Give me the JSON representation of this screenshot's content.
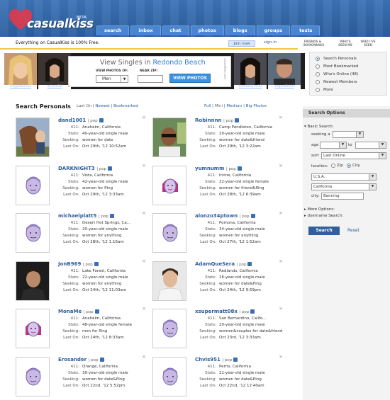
{
  "app": {
    "logo": "casualkiss",
    "beta": "BETA"
  },
  "nav_tabs": [
    "search",
    "inbox",
    "chat",
    "photos",
    "blogs",
    "groups",
    "tests"
  ],
  "top_strip": {
    "message": "Everything on CasualKiss is 100% Free.",
    "join": "Join now",
    "signin": "sign-in"
  },
  "right_tabs": [
    "FRIENDS & BOOKMARKS",
    "WHO'S SEEN ME",
    "WHO I'VE SEEN"
  ],
  "photo_strip": [
    {
      "name": "Heyjude2222"
    },
    {
      "name": "asian429"
    },
    {
      "name": "blonde4you30"
    },
    {
      "name": "Vegas40440"
    }
  ],
  "ad": {
    "title_prefix": "View Singles in",
    "city": "Redondo Beach",
    "view_photos_of_label": "VIEW PHOTOS OF:",
    "near_zip_label": "NEAR ZIP:",
    "gender_value": "Men",
    "button": "VIEW PHOTOS",
    "side_text": "casualkiss.com"
  },
  "right_menu": [
    {
      "label": "Search Personals",
      "selected": true
    },
    {
      "label": "Most Bookmarked",
      "selected": false
    },
    {
      "label": "Who's Online (48)",
      "selected": false
    },
    {
      "label": "Newest Members",
      "selected": false
    },
    {
      "label": "More",
      "selected": false
    }
  ],
  "search_heading": {
    "title": "Search Personals",
    "sort_links": [
      "Last On",
      "Newest",
      "Bookmarked"
    ],
    "view_links": [
      "Full",
      "Mini",
      "Medium",
      "Big Photos"
    ]
  },
  "profiles": [
    {
      "name": "dand1001",
      "pop": "pop",
      "avatar": "photo-horse",
      "r411": "Anaheim, California",
      "stats": "40-year-old single male",
      "seeking": "women for date",
      "last_on": "Oct 29th, '12 10:52am"
    },
    {
      "name": "Robinnnn",
      "pop": "pop",
      "avatar": "photo-man-sunglasses",
      "r411": "Camp Pendleton, California",
      "stats": "20-year-old single male",
      "seeking": "women for date&friend",
      "last_on": "Oct 29th, '12 3:22am"
    },
    {
      "name": "DARKNIGHT3",
      "pop": "pop",
      "avatar": "default-male",
      "r411": "Vista, California",
      "stats": "42-year-old single male",
      "seeking": "women for fling",
      "last_on": "Oct 29th, '12 3:33am"
    },
    {
      "name": "yumnumm",
      "pop": "pop",
      "avatar": "default-female",
      "r411": "Irvine, California",
      "stats": "22-year-old single female",
      "seeking": "women for friend&fling",
      "last_on": "Oct 28th, '12 6:39am"
    },
    {
      "name": "michaelplatt5",
      "pop": "pop",
      "avatar": "default-male",
      "r411": "Desert Hot Springs, Ca...",
      "stats": "20-year-old single male",
      "seeking": "women for anything",
      "last_on": "Oct 28th, '12 1:16am"
    },
    {
      "name": "alonzo34ptown",
      "pop": "pop",
      "avatar": "default-male",
      "r411": "Pomona, California",
      "stats": "34-year-old single male",
      "seeking": "women for anything",
      "last_on": "Oct 27th, '12 1:52am"
    },
    {
      "name": "JonB969",
      "pop": "pop",
      "avatar": "photo-man-dark",
      "r411": "Lake Forest, California",
      "stats": "22-year-old single male",
      "seeking": "women for anything",
      "last_on": "Oct 24th, '12 11:03am"
    },
    {
      "name": "AdamQueSera",
      "pop": "pop",
      "avatar": "photo-man-light",
      "r411": "Redlands, California",
      "stats": "26-year-old single male",
      "seeking": "women for date&fling",
      "last_on": "Oct 24th, '12 9:59pm"
    },
    {
      "name": "MonaMe",
      "pop": "pop",
      "avatar": "default-female",
      "r411": "Anaheim, California",
      "stats": "48-year-old single female",
      "seeking": "men for fling",
      "last_on": "Oct 24th, '12 8:33am"
    },
    {
      "name": "xsupermatt08x",
      "pop": "pop",
      "avatar": "default-male",
      "r411": "San Bernardino, Califo...",
      "stats": "20-year-old single male",
      "seeking": "women&couples for date&friend",
      "last_on": "Oct 23rd, '12 3:33am"
    },
    {
      "name": "Erosander",
      "pop": "pop",
      "avatar": "default-male",
      "r411": "Orange, California",
      "stats": "30-year-old single male",
      "seeking": "women for date&fling",
      "last_on": "Oct 22nd, '12 5:52pm"
    },
    {
      "name": "Chvis951",
      "pop": "pop",
      "avatar": "default-male",
      "r411": "Perris, California",
      "stats": "21-year-old single male",
      "seeking": "women for date&fling",
      "last_on": "Oct 22nd, '12 12:40am"
    }
  ],
  "row_labels": {
    "r411": "411:",
    "stats": "Stats:",
    "seeking": "Seeking:",
    "last_on": "Last On:"
  },
  "search_options": {
    "heading": "Search Options",
    "basic": "Basic Search:",
    "seeking_label": "seeking a",
    "age_label": "age",
    "age_to": "to",
    "sort_label": "sort",
    "sort_value": "Last Online",
    "location_label": "location:",
    "zip_label": "Zip",
    "city_label": "City",
    "country_value": "U.S.A.",
    "state_value": "California",
    "city_field_label": "city:",
    "city_value": "Banning",
    "more_options": "More Options:",
    "username_search": "Username Search:",
    "search_button": "Search",
    "reset": "Reset"
  }
}
